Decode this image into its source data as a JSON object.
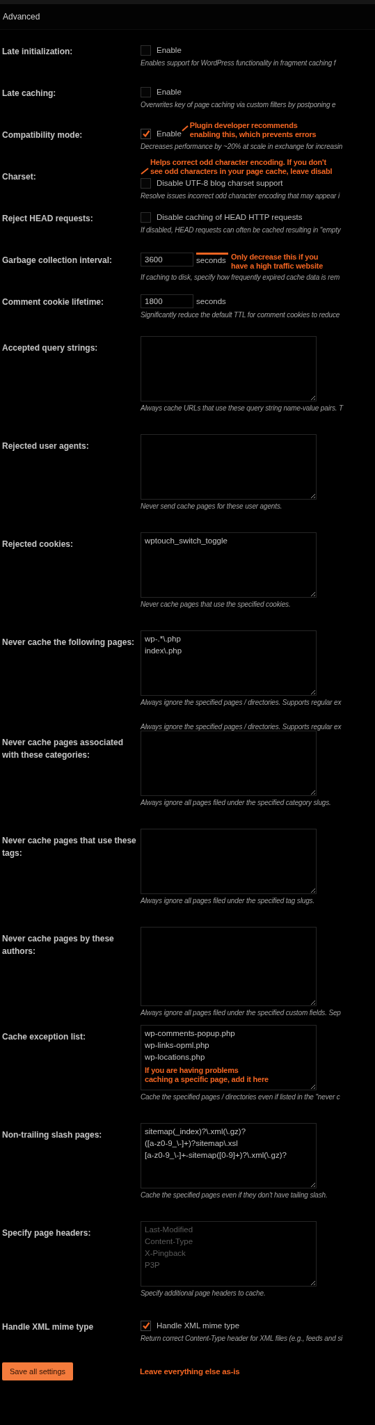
{
  "section": {
    "title": "Advanced"
  },
  "settings": [
    {
      "kind": "checkbox",
      "label": "Late initialization:",
      "option": "Enable",
      "checked": false,
      "descriptions": [
        "Enables support for WordPress functionality in fragment caching f"
      ]
    },
    {
      "kind": "checkbox",
      "label": "Late caching:",
      "option": "Enable",
      "checked": false,
      "descriptions": [
        "Overwrites key of page caching via custom filters by postponing e"
      ]
    },
    {
      "kind": "checkbox",
      "label": "Compatibility mode:",
      "option": "Enable",
      "checked": true,
      "descriptions": [
        "Decreases performance by ~20% at scale in exchange for increasin"
      ],
      "annotation": {
        "kind": "beside",
        "lines": [
          "Plugin developer recommends",
          "enabling this, which prevents errors"
        ]
      }
    },
    {
      "kind": "checkbox",
      "label": "Charset:",
      "option": "Disable UTF-8 blog charset support",
      "checked": false,
      "descriptions": [
        "Resolve issues incorrect odd character encoding that may appear i"
      ],
      "annotation": {
        "kind": "above",
        "lines": [
          "Helps correct odd character encoding. If you don't",
          "see odd characters in your page cache, leave disabl"
        ]
      }
    },
    {
      "kind": "checkbox",
      "label": "Reject HEAD requests:",
      "option": "Disable caching of HEAD HTTP requests",
      "checked": false,
      "descriptions": [
        "If disabled, HEAD requests can often be cached resulting in \"empty"
      ]
    },
    {
      "kind": "number",
      "label": "Garbage collection interval:",
      "value": "3600",
      "unit": "seconds",
      "descriptions": [
        "If caching to disk, specify how frequently expired cache data is rem"
      ],
      "annotation": {
        "kind": "beside",
        "lines": [
          "Only decrease this if you",
          "have a high traffic website"
        ]
      }
    },
    {
      "kind": "number",
      "label": "Comment cookie lifetime:",
      "value": "1800",
      "unit": "seconds",
      "descriptions": [
        "Significantly reduce the default TTL for comment cookies to reduce"
      ]
    },
    {
      "kind": "textarea",
      "label": "Accepted query strings:",
      "descriptions": [
        "Always cache URLs that use these query string name-value pairs. T"
      ]
    },
    {
      "kind": "textarea",
      "label": "Rejected user agents:",
      "descriptions": [
        "Never send cache pages for these user agents."
      ]
    },
    {
      "kind": "textarea",
      "label": "Rejected cookies:",
      "value": "wptouch_switch_toggle",
      "descriptions": [
        "Never cache pages that use the specified cookies."
      ]
    },
    {
      "kind": "textarea",
      "label": "Never cache the following pages:",
      "value": "wp-.*\\.php\nindex\\.php",
      "descriptions": [
        "Always ignore the specified pages / directories. Supports regular ex",
        "Always ignore the specified pages / directories. Supports regular ex"
      ]
    },
    {
      "kind": "textarea",
      "label": "Never cache pages associated with these categories:",
      "descriptions": [
        "Always ignore all pages filed under the specified category slugs."
      ]
    },
    {
      "kind": "textarea",
      "label": "Never cache pages that use these tags:",
      "descriptions": [
        "Always ignore all pages filed under the specified tag slugs."
      ]
    },
    {
      "kind": "textarea",
      "label": "Never cache pages by these authors:",
      "tall": true,
      "descriptions": [
        "Always ignore all pages filed under the specified custom fields. Sep"
      ]
    },
    {
      "kind": "textarea",
      "label": "Cache exception list:",
      "value": "wp-comments-popup.php\nwp-links-opml.php\nwp-locations.php",
      "descriptions": [
        "Cache the specified pages / directories even if listed in the \"never c"
      ],
      "annotation": {
        "kind": "inside",
        "lines": [
          "If you are having problems",
          "caching a specific page, add it here"
        ]
      }
    },
    {
      "kind": "textarea",
      "label": "Non-trailing slash pages:",
      "value": "sitemap(_index)?\\.xml(\\.gz)?\n([a-z0-9_\\-]+)?sitemap\\.xsl\n[a-z0-9_\\-]+-sitemap([0-9]+)?\\.xml(\\.gz)?",
      "descriptions": [
        "Cache the specified pages even if they don't have tailing slash."
      ]
    },
    {
      "kind": "textarea",
      "label": "Specify page headers:",
      "placeholder": "Last-Modified\nContent-Type\nX-Pingback\nP3P",
      "descriptions": [
        "Specify additional page headers to cache."
      ]
    },
    {
      "kind": "checkbox",
      "label": "Handle XML mime type",
      "option": "Handle XML mime type",
      "checked": true,
      "descriptions": [
        "Return correct Content-Type header for XML files (e.g., feeds and si"
      ]
    }
  ],
  "save_button": "Save all settings",
  "footer_annotation": "Leave everything else as-is"
}
